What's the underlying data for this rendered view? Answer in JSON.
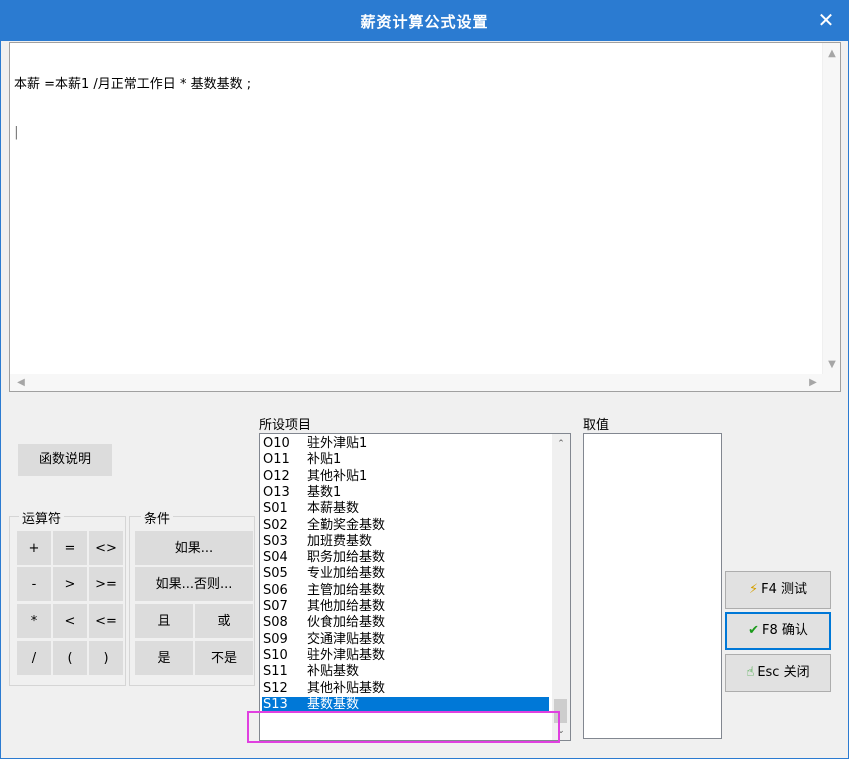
{
  "window": {
    "title": "薪资计算公式设置",
    "close_glyph": "✕"
  },
  "editor": {
    "formula": "本薪 =本薪1 /月正常工作日 * 基数基数 ;",
    "caret_line": "|"
  },
  "buttons": {
    "func_help": "函数说明"
  },
  "operators": {
    "group_label": "运算符",
    "rows": [
      [
        "+",
        "=",
        "<>"
      ],
      [
        "-",
        ">",
        ">="
      ],
      [
        "*",
        "<",
        "<="
      ],
      [
        "/",
        "(",
        ")"
      ]
    ]
  },
  "conditions": {
    "group_label": "条件",
    "if": "如果...",
    "if_else": "如果...否则...",
    "and": "且",
    "or": "或",
    "yes": "是",
    "no": "不是"
  },
  "items": {
    "label": "所设项目",
    "list": [
      {
        "code": "O10",
        "name": "驻外津贴1"
      },
      {
        "code": "O11",
        "name": "补贴1"
      },
      {
        "code": "O12",
        "name": "其他补贴1"
      },
      {
        "code": "O13",
        "name": "基数1"
      },
      {
        "code": "S01",
        "name": "本薪基数"
      },
      {
        "code": "S02",
        "name": "全勤奖金基数"
      },
      {
        "code": "S03",
        "name": "加班费基数"
      },
      {
        "code": "S04",
        "name": "职务加给基数"
      },
      {
        "code": "S05",
        "name": "专业加给基数"
      },
      {
        "code": "S06",
        "name": "主管加给基数"
      },
      {
        "code": "S07",
        "name": "其他加给基数"
      },
      {
        "code": "S08",
        "name": "伙食加给基数"
      },
      {
        "code": "S09",
        "name": "交通津贴基数"
      },
      {
        "code": "S10",
        "name": "驻外津贴基数"
      },
      {
        "code": "S11",
        "name": "补贴基数"
      },
      {
        "code": "S12",
        "name": "其他补贴基数"
      },
      {
        "code": "S13",
        "name": "基数基数"
      }
    ],
    "selected_index": 16
  },
  "value": {
    "label": "取值"
  },
  "actions": {
    "test": "F4 测试",
    "confirm": "F8 确认",
    "close": "Esc 关闭"
  },
  "colors": {
    "accent": "#2b7bd1",
    "selection": "#0078d7",
    "highlight": "#e040e0"
  }
}
